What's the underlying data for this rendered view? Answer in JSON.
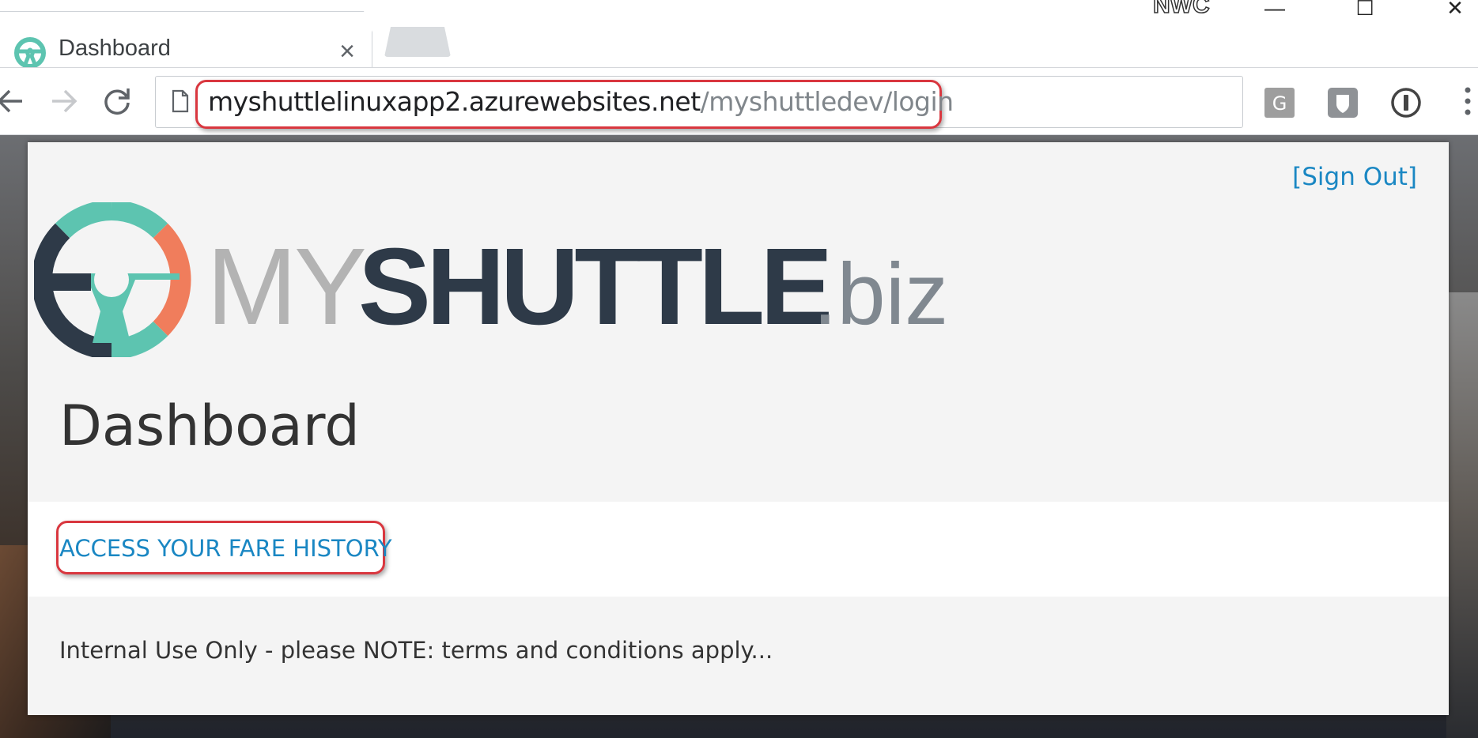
{
  "browser": {
    "tab": {
      "title": "Dashboard",
      "close_glyph": "×",
      "icon": "myshuttle-steering-wheel-icon"
    },
    "window_badge": "NWC",
    "window_controls": {
      "minimize": "—",
      "maximize": "☐",
      "close": "✕"
    },
    "address_bar": {
      "host": "myshuttlelinuxapp2.azurewebsites.net",
      "path": "/myshuttledev/login"
    },
    "extensions": [
      "google-translate-icon",
      "ghostery-icon",
      "1password-icon"
    ]
  },
  "page": {
    "sign_out_label": "[Sign Out]",
    "logo": {
      "part1": "MY",
      "part2": "SHUTTLE",
      "part3": ".biz"
    },
    "title": "Dashboard",
    "fare_history_link": "ACCESS YOUR FARE HISTORY",
    "footer_note": "Internal Use Only - please NOTE: terms and conditions apply..."
  },
  "colors": {
    "link": "#1a87c3",
    "highlight": "#d9373f",
    "logo_teal": "#5dc4b0",
    "logo_orange": "#f07d5c",
    "logo_navy": "#2e3a48"
  }
}
